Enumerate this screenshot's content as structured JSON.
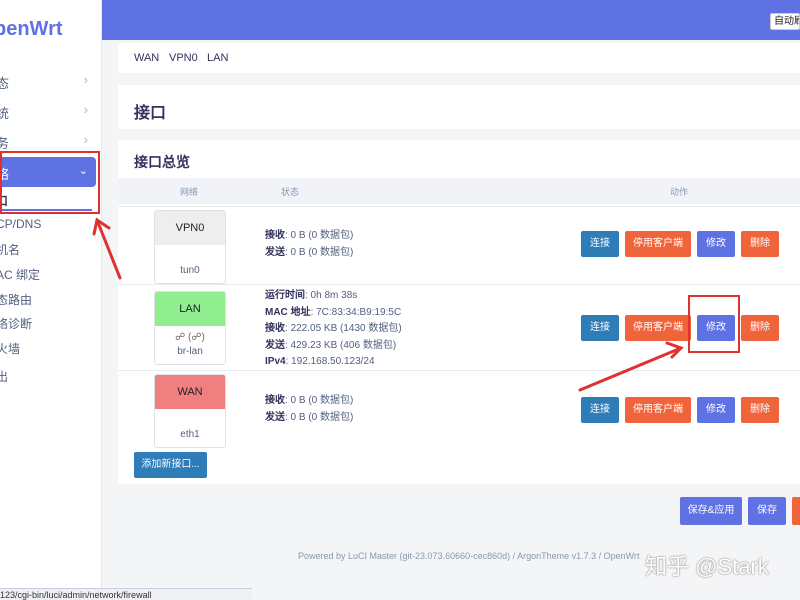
{
  "brand": "penWrt",
  "sidebar": {
    "items": [
      {
        "label": "态"
      },
      {
        "label": "统"
      },
      {
        "label": "务"
      },
      {
        "label": "络"
      }
    ],
    "sub": [
      {
        "label": "口"
      },
      {
        "label": "CP/DNS"
      },
      {
        "label": "机名"
      },
      {
        "label": "AC 绑定"
      },
      {
        "label": "态路由"
      },
      {
        "label": "络诊断"
      },
      {
        "label": "火墙"
      },
      {
        "label": "出"
      }
    ]
  },
  "header": {
    "auto_label": "自动刷新"
  },
  "tabs": [
    "WAN",
    "VPN0",
    "LAN"
  ],
  "page_title": "接口",
  "section_title": "接口总览",
  "table": {
    "headers": [
      "网络",
      "状态",
      "动作"
    ],
    "rows": [
      {
        "name": "VPN0",
        "device": "tun0",
        "icons": "",
        "color": "#eeeeee",
        "status": [
          {
            "k": "接收",
            "v": ": 0 B (0 数据包)"
          },
          {
            "k": "发送",
            "v": ": 0 B (0 数据包)"
          }
        ]
      },
      {
        "name": "LAN",
        "device": "br-lan",
        "icons": "☍ (☍)",
        "color": "#90ee90",
        "status": [
          {
            "k": "运行时间",
            "v": ": 0h 8m 38s"
          },
          {
            "k": "MAC 地址",
            "v": ": 7C:83:34:B9:19:5C"
          },
          {
            "k": "接收",
            "v": ": 222.05 KB (1430 数据包)"
          },
          {
            "k": "发送",
            "v": ": 429.23 KB (406 数据包)"
          },
          {
            "k": "IPv4",
            "v": ": 192.168.50.123/24"
          }
        ]
      },
      {
        "name": "WAN",
        "device": "eth1",
        "icons": "",
        "color": "#f08080",
        "status": [
          {
            "k": "接收",
            "v": ": 0 B (0 数据包)"
          },
          {
            "k": "发送",
            "v": ": 0 B (0 数据包)"
          }
        ]
      }
    ],
    "actions": {
      "connect": "连接",
      "stop": "停用客户端",
      "edit": "修改",
      "delete": "删除"
    }
  },
  "add_interface": "添加新接口...",
  "buttons": {
    "save_apply": "保存&应用",
    "save": "保存"
  },
  "footer": "Powered by LuCI Master (git-23.073.60660-cec860d) / ArgonTheme v1.7.3 / OpenWrt",
  "status_url": "123/cgi-bin/luci/admin/network/firewall",
  "watermark": "知乎 @Stark",
  "colors": {
    "accent": "#5e72e4",
    "danger": "#f0643c",
    "info": "#2e7cb8",
    "annotation": "#e03131"
  }
}
